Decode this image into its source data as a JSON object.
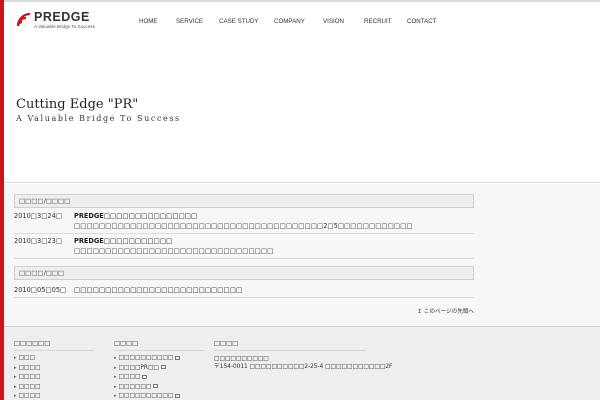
{
  "logo": {
    "name": "PREDGE",
    "tagline": "A Valuable Bridge To Success"
  },
  "nav": [
    {
      "label": "HOME"
    },
    {
      "label": "SERVICE"
    },
    {
      "label": "CASE STUDY"
    },
    {
      "label": "COMPANY"
    },
    {
      "label": "VISION"
    },
    {
      "label": "RECRUIT"
    },
    {
      "label": "CONTACT"
    }
  ],
  "hero": {
    "title": "Cutting Edge \"PR\"",
    "subtitle": "A Valuable Bridge To Success"
  },
  "sections": [
    {
      "header": "□□□□/□□□□",
      "items": [
        {
          "date": "2010□3□24□",
          "title": "PREDGE□□□□□□□□□□□□□□□",
          "desc": "□□□□□□□□□□□□□□□□□□□□□□□□□□□□□□□□□□□□□□□□2□5□□□□□□□□□□□□"
        },
        {
          "date": "2010□3□23□",
          "title": "PREDGE□□□□□□□□□□□",
          "desc": "□□□□□□□□□□□□□□□□□□□□□□□□□□□□□□□□"
        }
      ]
    },
    {
      "header": "□□□□/□□□",
      "items": [
        {
          "date": "2010□05□05□",
          "title": "□□□□□□□□□□□□□□□□□□□□□□□□□□□",
          "desc": ""
        }
      ]
    }
  ],
  "page_top": "↥ このページの先頭へ",
  "footer": {
    "col1": {
      "title": "□□□□□□",
      "items": [
        "□□□",
        "□□□□",
        "□□□□",
        "□□□□",
        "□□□□",
        "□□□□"
      ]
    },
    "col2": {
      "title": "□□□□",
      "items": [
        "□□□□□□□□□□",
        "□□□□PR□□",
        "□□□□",
        "□□□□□□",
        "□□□□□□□□□□"
      ]
    },
    "col3": {
      "title": "□□□□",
      "name": "□□□□□□□□□□",
      "address": "〒154-0011 □□□□□□□□□□2-25-4 □□□□□□□□□□□2F"
    }
  }
}
